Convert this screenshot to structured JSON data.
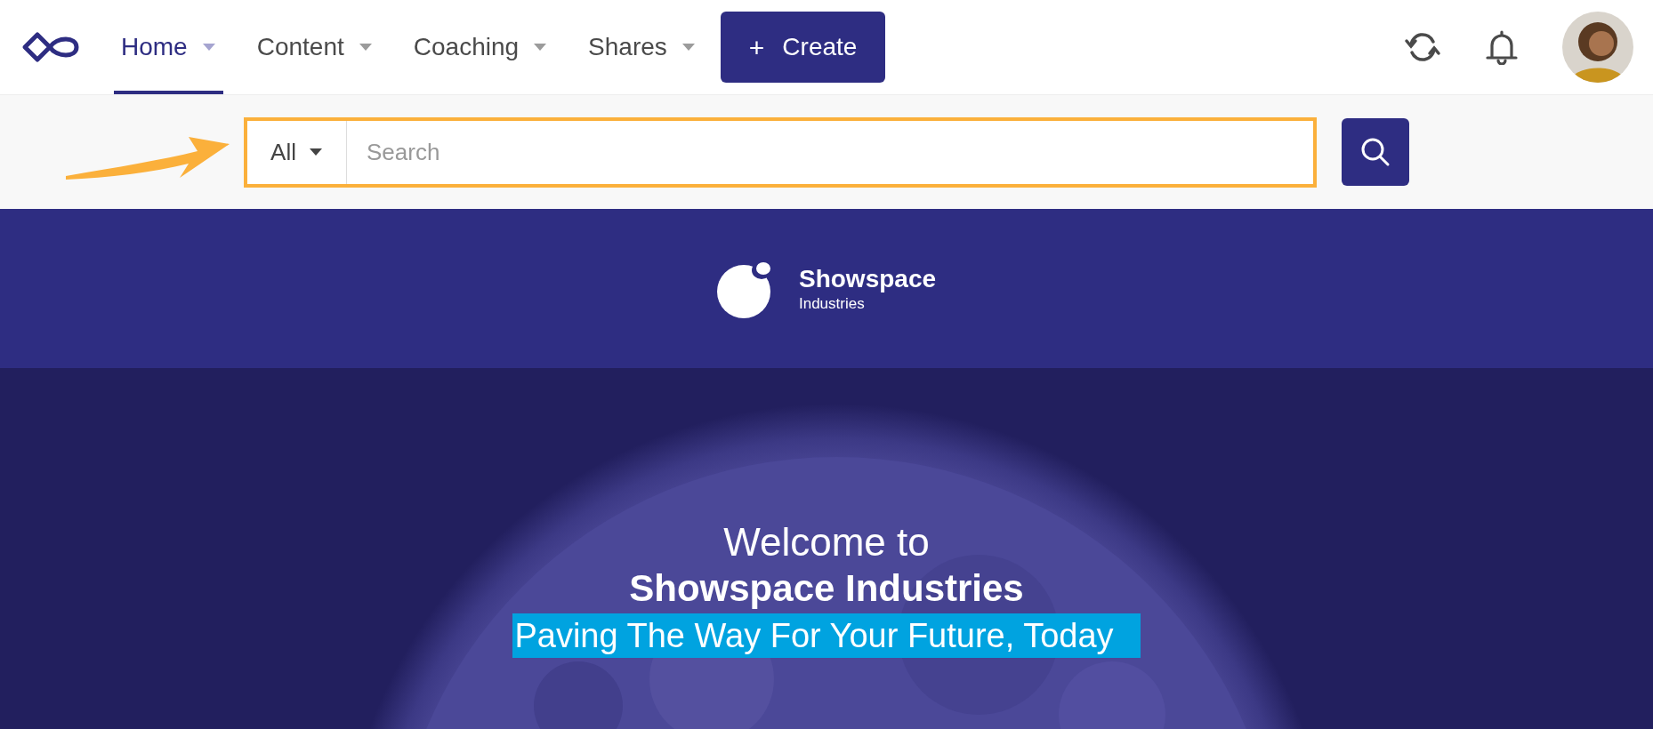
{
  "nav": {
    "tabs": [
      {
        "label": "Home",
        "selected": true
      },
      {
        "label": "Content",
        "selected": false
      },
      {
        "label": "Coaching",
        "selected": false
      },
      {
        "label": "Shares",
        "selected": false
      }
    ],
    "create_button": {
      "icon": "+",
      "label": "Create"
    }
  },
  "search": {
    "scope": "All",
    "placeholder": "Search"
  },
  "brand": {
    "name": "Showspace",
    "subtitle": "Industries"
  },
  "hero": {
    "kind": "picture",
    "greeting": "Welcome to",
    "title": "Showspace Industries",
    "tagline": "Paving The Way For Your Future, Today"
  }
}
